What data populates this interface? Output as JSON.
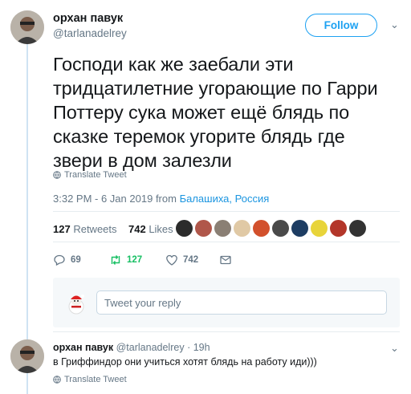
{
  "tweet": {
    "author_name": "орхан павук",
    "author_handle": "@tarlanadelrey",
    "follow_label": "Follow",
    "text": "Господи как же заебали эти тридцатилетние угорающие по Гарри Поттеру сука может ещё блядь по сказке теремок угорите блядь где звери в дом залезли",
    "translate_label": "Translate Tweet",
    "timestamp": "3:32 PM - 6 Jan 2019",
    "from_label": "from",
    "location": "Балашиха, Россия",
    "retweets_count": "127",
    "retweets_label": "Retweets",
    "likes_count": "742",
    "likes_label": "Likes",
    "actions": {
      "replies": "69",
      "retweets": "127",
      "likes": "742"
    }
  },
  "reply_composer": {
    "placeholder": "Tweet your reply"
  },
  "reply": {
    "author_name": "орхан павук",
    "author_handle": "@tarlanadelrey",
    "time": "· 19h",
    "text": "в Гриффиндор они учиться хотят блядь на работу иди)))",
    "translate_label": "Translate Tweet"
  },
  "colors": {
    "accent": "#1da1f2",
    "retweet_green": "#17bf63",
    "muted": "#657786"
  }
}
